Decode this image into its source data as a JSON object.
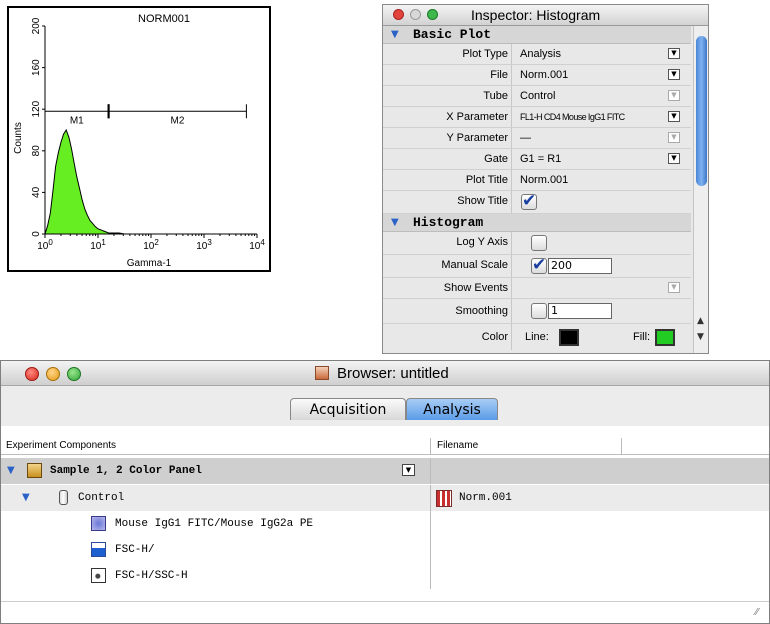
{
  "plot": {
    "title": "NORM001",
    "ylabel": "Counts",
    "xlabel": "Gamma-1",
    "yticks": [
      "0",
      "40",
      "80",
      "120",
      "160",
      "200"
    ],
    "xticks": [
      {
        "base": "10",
        "exp": "0"
      },
      {
        "base": "10",
        "exp": "1"
      },
      {
        "base": "10",
        "exp": "2"
      },
      {
        "base": "10",
        "exp": "3"
      },
      {
        "base": "10",
        "exp": "4"
      }
    ],
    "markers": [
      {
        "label": "M1",
        "from_decade": 0.0,
        "to_decade": 1.2
      },
      {
        "label": "M2",
        "from_decade": 1.2,
        "to_decade": 3.8
      }
    ],
    "fill_color": "#66ee22"
  },
  "chart_data": {
    "type": "area",
    "title": "NORM001",
    "xlabel": "Gamma-1",
    "ylabel": "Counts",
    "xscale": "log",
    "xlim": [
      1,
      10000
    ],
    "ylim": [
      0,
      200
    ],
    "x_decades": [
      0.05,
      0.1,
      0.15,
      0.2,
      0.25,
      0.3,
      0.35,
      0.4,
      0.45,
      0.5,
      0.55,
      0.6,
      0.65,
      0.7,
      0.75,
      0.8,
      0.85,
      0.9,
      0.95,
      1.0,
      1.05,
      1.1,
      1.15,
      1.2,
      1.3,
      1.4,
      1.5
    ],
    "counts": [
      8,
      20,
      42,
      65,
      78,
      88,
      96,
      100,
      93,
      82,
      68,
      55,
      44,
      33,
      24,
      18,
      13,
      10,
      7,
      5,
      4,
      3,
      2,
      1,
      1,
      1,
      0
    ]
  },
  "inspector": {
    "title": "Inspector: Histogram",
    "sections": [
      {
        "label": "Basic Plot"
      },
      {
        "label": "Histogram"
      }
    ],
    "rows": {
      "plot_type": {
        "label": "Plot Type",
        "value": "Analysis"
      },
      "file": {
        "label": "File",
        "value": "Norm.001"
      },
      "tube": {
        "label": "Tube",
        "value": "Control"
      },
      "x_param": {
        "label": "X Parameter",
        "value": "FL1-H CD4 Mouse IgG1 FITC"
      },
      "y_param": {
        "label": "Y Parameter",
        "value": "—"
      },
      "gate": {
        "label": "Gate",
        "value": "G1 = R1"
      },
      "plot_title": {
        "label": "Plot Title",
        "value": "Norm.001"
      },
      "show_title": {
        "label": "Show Title"
      },
      "log_y": {
        "label": "Log Y Axis"
      },
      "manual_scale": {
        "label": "Manual Scale",
        "value": "200"
      },
      "show_events": {
        "label": "Show Events"
      },
      "smoothing": {
        "label": "Smoothing",
        "value": "1"
      },
      "color": {
        "label": "Color",
        "line_label": "Line:",
        "fill_label": "Fill:",
        "line_color": "#000000",
        "fill_color": "#22cc22"
      }
    }
  },
  "browser": {
    "title": "Browser: untitled",
    "tabs": [
      {
        "label": "Acquisition"
      },
      {
        "label": "Analysis"
      }
    ],
    "columns": [
      "Experiment Components",
      "Filename"
    ],
    "rows": {
      "sample": {
        "label": "Sample 1, 2 Color Panel"
      },
      "control": {
        "label": "Control",
        "filename": "Norm.001"
      },
      "item1": {
        "label": "Mouse IgG1 FITC/Mouse IgG2a PE"
      },
      "item2": {
        "label": "FSC-H/"
      },
      "item3": {
        "label": "FSC-H/SSC-H"
      }
    }
  }
}
